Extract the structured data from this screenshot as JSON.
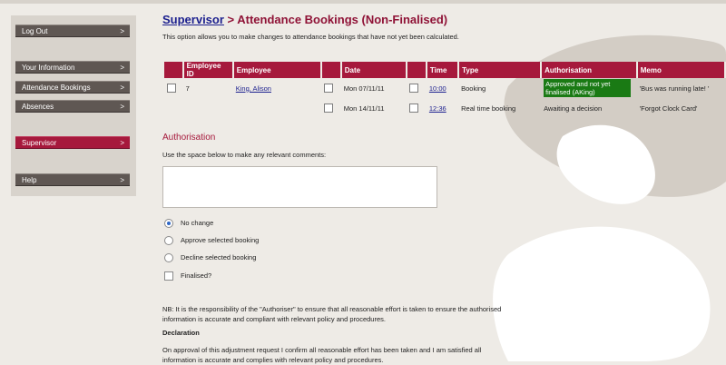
{
  "sidebar": {
    "items": [
      {
        "label": "Log Out",
        "arrow": ">"
      },
      {
        "label": "Your Information",
        "arrow": ">"
      },
      {
        "label": "Attendance Bookings",
        "arrow": ">"
      },
      {
        "label": "Absences",
        "arrow": ">"
      },
      {
        "label": "Supervisor",
        "arrow": ">"
      },
      {
        "label": "Help",
        "arrow": ">"
      }
    ]
  },
  "header": {
    "breadcrumb_link": "Supervisor",
    "title_rest": " > Attendance Bookings (Non-Finalised)",
    "intro": "This option allows you to make changes to attendance bookings that have not yet been calculated."
  },
  "table": {
    "columns": [
      "Employee ID",
      "Employee",
      "Date",
      "Time",
      "Type",
      "Authorisation",
      "Memo"
    ],
    "rows": [
      {
        "employee_id": "7",
        "employee": "King, Alison",
        "date": "Mon 07/11/11",
        "time": "10:00",
        "type": "Booking",
        "authorisation": "Approved and not yet finalised (AKing)",
        "memo": "'Bus was running late! '"
      },
      {
        "employee_id": "",
        "employee": "",
        "date": "Mon 14/11/11",
        "time": "12:36",
        "type": "Real time booking",
        "authorisation": "Awaiting a decision",
        "memo": "'Forgot Clock Card'"
      }
    ]
  },
  "authorisation": {
    "title": "Authorisation",
    "hint": "Use the space below to make any relevant comments:",
    "comments_value": "",
    "options": [
      "No change",
      "Approve selected booking",
      "Decline selected booking"
    ],
    "finalised_label": "Finalised?"
  },
  "notes": {
    "nb": "NB: It is the responsibility of the \"Authoriser\" to ensure that all reasonable effort is taken to ensure the authorised information is accurate and compliant with relevant policy and procedures.",
    "declaration_title": "Declaration",
    "declaration": "On approval of this adjustment request I confirm all reasonable effort has been taken and I am satisfied all information is accurate and complies with relevant policy and procedures."
  },
  "colors": {
    "accent": "#a6193c",
    "nav": "#5f5753",
    "approved": "#1a7a14",
    "link": "#1b1f8e"
  }
}
